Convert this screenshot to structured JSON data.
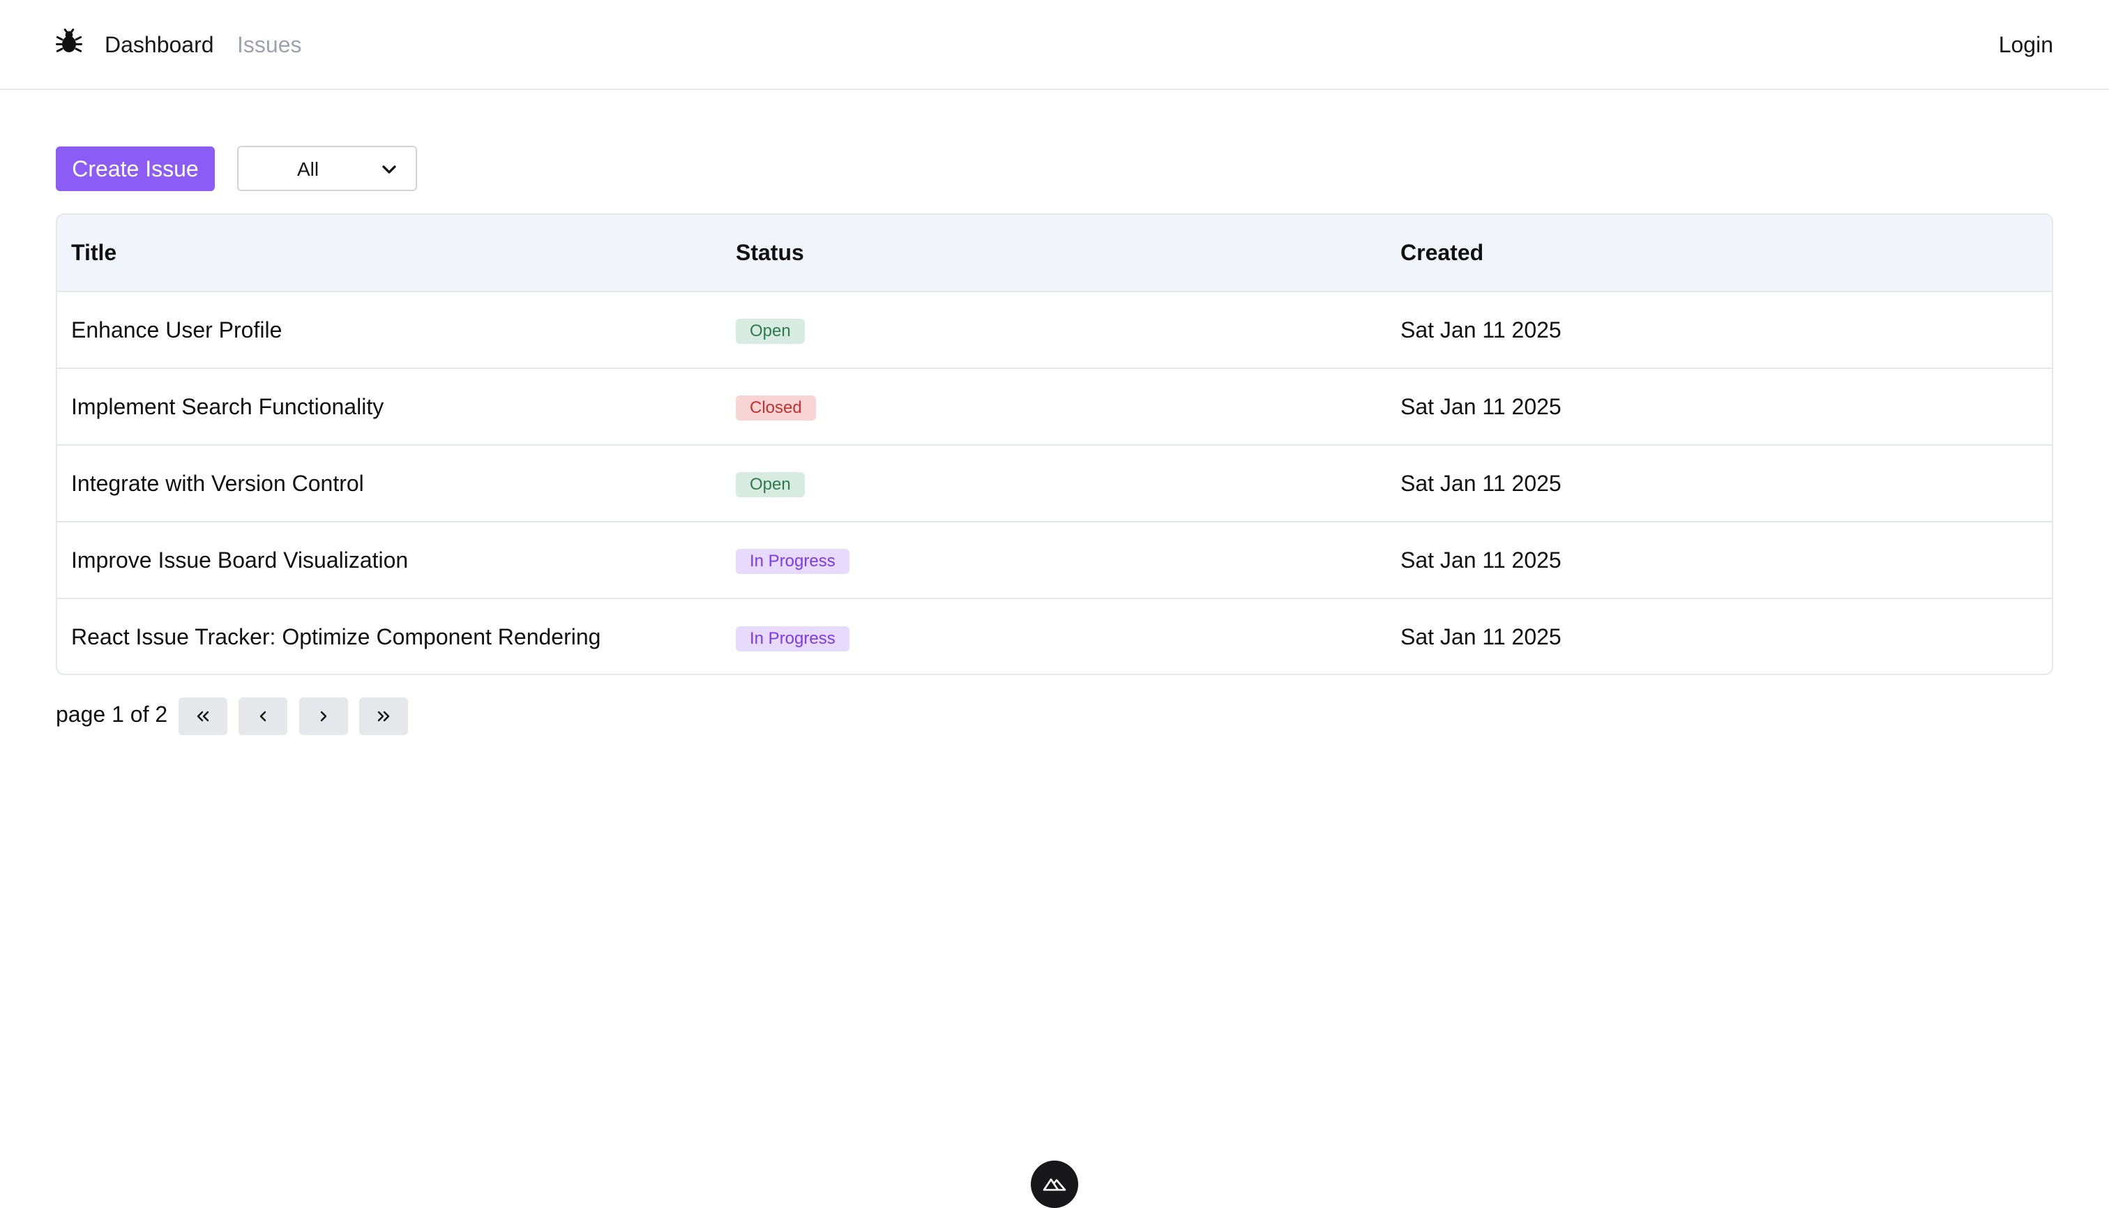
{
  "nav": {
    "logo_icon": "bug-icon",
    "dashboard_label": "Dashboard",
    "issues_label": "Issues",
    "login_label": "Login"
  },
  "toolbar": {
    "create_label": "Create Issue",
    "filter_value": "All"
  },
  "table": {
    "headers": [
      "Title",
      "Status",
      "Created"
    ],
    "rows": [
      {
        "title": "Enhance User Profile",
        "status": "Open",
        "created": "Sat Jan 11 2025"
      },
      {
        "title": "Implement Search Functionality",
        "status": "Closed",
        "created": "Sat Jan 11 2025"
      },
      {
        "title": "Integrate with Version Control",
        "status": "Open",
        "created": "Sat Jan 11 2025"
      },
      {
        "title": "Improve Issue Board Visualization",
        "status": "In Progress",
        "created": "Sat Jan 11 2025"
      },
      {
        "title": "React Issue Tracker: Optimize Component Rendering",
        "status": "In Progress",
        "created": "Sat Jan 11 2025"
      }
    ]
  },
  "pagination": {
    "text": "page 1 of 2"
  },
  "colors": {
    "accent": "#8b5cf6",
    "open": "#2f7a4f",
    "closed": "#c53030",
    "in_progress": "#7c3aed"
  }
}
